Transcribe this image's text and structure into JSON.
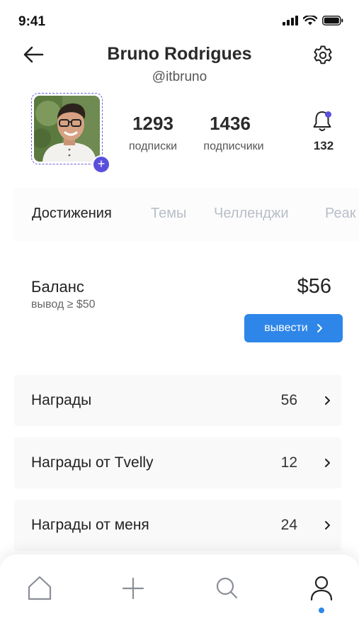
{
  "status": {
    "time": "9:41"
  },
  "header": {
    "name": "Bruno Rodrigues",
    "handle": "@itbruno"
  },
  "profile": {
    "following_count": "1293",
    "following_label": "подписки",
    "followers_count": "1436",
    "followers_label": "подписчики",
    "notifications_count": "132"
  },
  "tabs": [
    {
      "label": "Достижения",
      "active": true
    },
    {
      "label": "Темы",
      "active": false
    },
    {
      "label": "Челленджи",
      "active": false
    },
    {
      "label": "Реак",
      "active": false
    }
  ],
  "balance": {
    "title": "Баланс",
    "subtitle": "вывод ≥ $50",
    "amount": "$56",
    "withdraw_label": "вывести"
  },
  "rewards": [
    {
      "label": "Награды",
      "value": "56"
    },
    {
      "label": "Награды от Tvelly",
      "value": "12"
    },
    {
      "label": "Награды от меня",
      "value": "24"
    }
  ],
  "colors": {
    "accent": "#2e86e8",
    "avatar_accent": "#5a4fdc",
    "inactive_tab": "#b8bec8"
  },
  "nav": {
    "items": [
      "home-icon",
      "plus-icon",
      "search-icon",
      "profile-icon"
    ],
    "active": "profile-icon"
  }
}
